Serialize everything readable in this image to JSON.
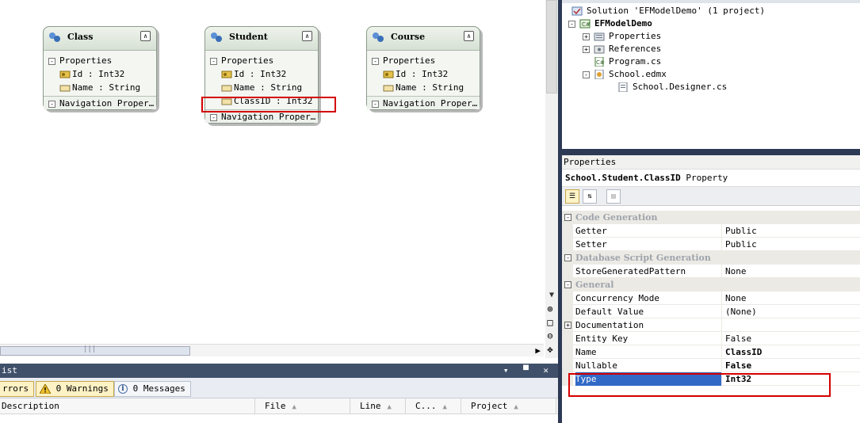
{
  "designer": {
    "entities": [
      {
        "name": "Class",
        "section": "Properties",
        "props": [
          {
            "text": "Id : Int32",
            "key": true
          },
          {
            "text": "Name : String",
            "key": false
          }
        ],
        "nav": "Navigation Proper…"
      },
      {
        "name": "Student",
        "section": "Properties",
        "props": [
          {
            "text": "Id : Int32",
            "key": true
          },
          {
            "text": "Name : String",
            "key": false
          },
          {
            "text": "ClassID : Int32",
            "key": false
          }
        ],
        "nav": "Navigation Proper…"
      },
      {
        "name": "Course",
        "section": "Properties",
        "props": [
          {
            "text": "Id : Int32",
            "key": true
          },
          {
            "text": "Name : String",
            "key": false
          }
        ],
        "nav": "Navigation Proper…"
      }
    ],
    "scroll_glyph": "|||"
  },
  "error_list": {
    "title": "ist",
    "controls": "▾ ▀ ✕",
    "errors_label": "rrors",
    "warnings_label": "0 Warnings",
    "messages_label": "0 Messages",
    "columns": [
      "Description",
      "File",
      "Line",
      "C...",
      "Project"
    ]
  },
  "solution_explorer": {
    "solution": "Solution 'EFModelDemo' (1 project)",
    "project": "EFModelDemo",
    "items": [
      "Properties",
      "References",
      "Program.cs",
      "School.edmx"
    ],
    "designer_file": "School.Designer.cs"
  },
  "properties": {
    "panel_title": "Properties",
    "object_name": "School.Student.ClassID",
    "object_type": "Property",
    "categories": [
      {
        "name": "Code Generation",
        "rows": [
          [
            "Getter",
            "Public"
          ],
          [
            "Setter",
            "Public"
          ]
        ]
      },
      {
        "name": "Database Script Generation",
        "rows": [
          [
            "StoreGeneratedPattern",
            "None"
          ]
        ]
      },
      {
        "name": "General",
        "rows": [
          [
            "Concurrency Mode",
            "None"
          ],
          [
            "Default Value",
            "(None)"
          ],
          [
            "Documentation",
            ""
          ],
          [
            "Entity Key",
            "False"
          ],
          [
            "Name",
            "ClassID"
          ],
          [
            "Nullable",
            "False"
          ],
          [
            "Type",
            "Int32"
          ]
        ]
      }
    ]
  },
  "colors": {
    "selection": "#3169c6",
    "highlight": "#d40000",
    "panel_dark": "#2c3a55"
  }
}
